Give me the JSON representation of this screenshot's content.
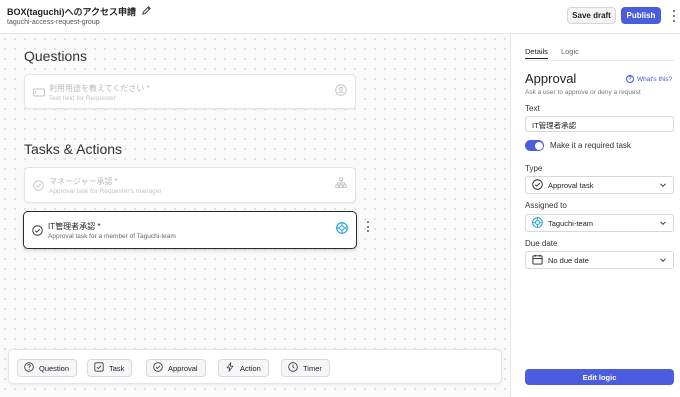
{
  "header": {
    "title": "BOX(taguchi)へのアクセス申請",
    "subtitle": "taguchi-access-request-group",
    "save_draft": "Save draft",
    "publish": "Publish"
  },
  "canvas": {
    "questions_title": "Questions",
    "questions": [
      {
        "title": "利用用途を教えてください *",
        "subtitle": "Text field for Requester",
        "icon": "text-field-icon",
        "right_icon": "person-icon"
      }
    ],
    "tasks_title": "Tasks & Actions",
    "tasks": [
      {
        "title": "マネージャー承認 *",
        "subtitle": "Approval task for Requester's manager",
        "icon": "check-circle-icon",
        "right_icon": "org-chart-icon",
        "selected": false
      },
      {
        "title": "IT管理者承認 *",
        "subtitle": "Approval task for a member of Taguchi-team",
        "icon": "check-circle-icon",
        "right_icon": "team-icon",
        "selected": true
      }
    ],
    "toolbar": [
      {
        "label": "Question",
        "icon": "question-icon"
      },
      {
        "label": "Task",
        "icon": "checkbox-icon"
      },
      {
        "label": "Approval",
        "icon": "check-circle-icon"
      },
      {
        "label": "Action",
        "icon": "lightning-icon"
      },
      {
        "label": "Timer",
        "icon": "clock-icon"
      }
    ]
  },
  "panel": {
    "tabs": [
      {
        "label": "Details",
        "active": true
      },
      {
        "label": "Logic",
        "active": false
      }
    ],
    "heading": "Approval",
    "whats_this": "What's this?",
    "description": "Ask a user to approve or deny a request",
    "text_label": "Text",
    "text_value": "IT管理者承認",
    "required_label": "Make it a required task",
    "required": true,
    "type_label": "Type",
    "type_value": "Approval task",
    "assigned_label": "Assigned to",
    "assigned_value": "Taguchi-team",
    "due_label": "Due date",
    "due_value": "No due date",
    "edit_logic": "Edit logic"
  },
  "colors": {
    "accent": "#4a5ddf",
    "link": "#3b5bdb",
    "team": "#1a9bd7"
  }
}
